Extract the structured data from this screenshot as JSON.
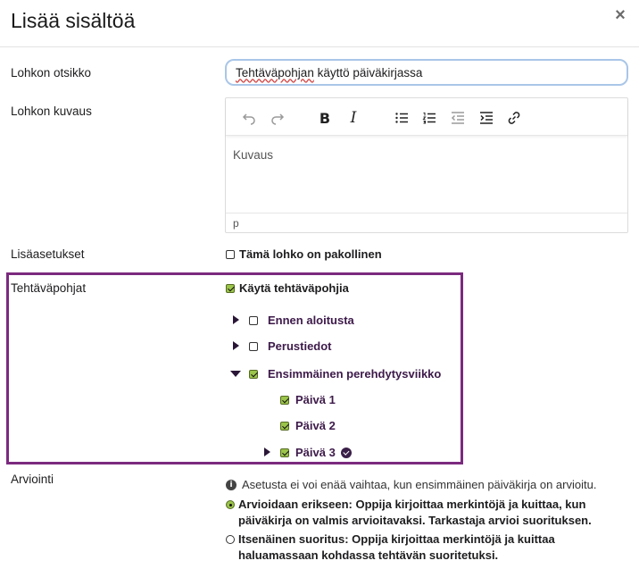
{
  "modal": {
    "title": "Lisää sisältöä",
    "close_label": "×"
  },
  "fields": {
    "block_title_label": "Lohkon otsikko",
    "block_title_value_part1": "Tehtäväpohjan",
    "block_title_value_part2": " käyttö päiväkirjassa",
    "block_description_label": "Lohkon kuvaus",
    "editor_placeholder": "Kuvaus",
    "editor_status_path": "p",
    "extra_settings_label": "Lisäasetukset",
    "required_checkbox_label": "Tämä lohko on pakollinen",
    "templates_label": "Tehtäväpohjat",
    "use_templates_label": "Käytä tehtäväpohjia",
    "evaluation_label": "Arviointi"
  },
  "toolbar": [
    "undo-icon",
    "redo-icon",
    "bold-icon",
    "italic-icon",
    "bullet-list-icon",
    "numbered-list-icon",
    "outdent-icon",
    "indent-icon",
    "link-icon"
  ],
  "template_tree": [
    {
      "label": "Ennen aloitusta",
      "checked": false,
      "expanded": false
    },
    {
      "label": "Perustiedot",
      "checked": false,
      "expanded": false
    },
    {
      "label": "Ensimmäinen perehdytysviikko",
      "checked": true,
      "expanded": true,
      "children": [
        {
          "label": "Päivä 1",
          "checked": true
        },
        {
          "label": "Päivä 2",
          "checked": true
        },
        {
          "label": "Päivä 3",
          "checked": true,
          "has_children": true,
          "complete": true
        }
      ]
    }
  ],
  "evaluation": {
    "info": "Asetusta ei voi enää vaihtaa, kun ensimmäinen päiväkirja on arvioitu.",
    "options": [
      {
        "title": "Arvioidaan erikseen:",
        "text": " Oppija kirjoittaa merkintöjä ja kuittaa, kun päiväkirja on valmis arvioitavaksi. Tarkastaja arvioi suorituksen.",
        "selected": true
      },
      {
        "title": "Itsenäinen suoritus:",
        "text": " Oppija kirjoittaa merkintöjä ja kuittaa haluamassaan kohdassa tehtävän suoritetuksi.",
        "selected": false
      }
    ]
  },
  "colors": {
    "highlight_border": "#7b2a7f",
    "checkbox_checked": "#9bc44a",
    "tree_text": "#3d1a4a",
    "input_focus_border": "#a9c6e8"
  }
}
